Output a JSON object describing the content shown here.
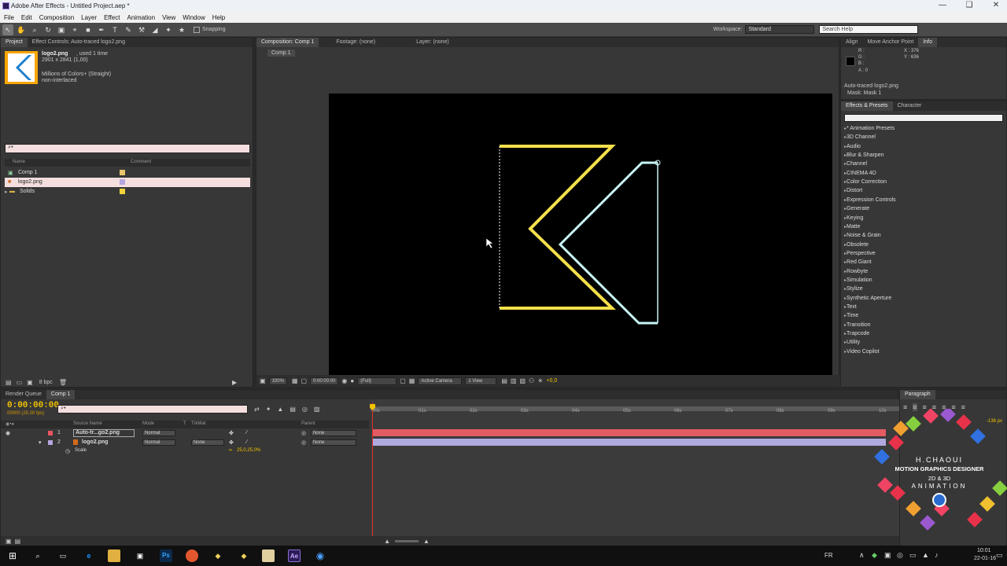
{
  "window": {
    "title": "Adobe After Effects - Untitled Project.aep *",
    "controls": [
      "—",
      "❑",
      "✕"
    ]
  },
  "menu": [
    "File",
    "Edit",
    "Composition",
    "Layer",
    "Effect",
    "Animation",
    "View",
    "Window",
    "Help"
  ],
  "toolbar": {
    "snapping_label": "Snapping",
    "workspace_label": "Workspace:",
    "workspace_value": "Standard",
    "search_placeholder": "Search Help"
  },
  "project_panel": {
    "tab_project": "Project",
    "tab_effect_controls": "Effect Controls: Auto-traced logo2.png",
    "selected_name": "logo2.png",
    "used": ", used 1 time",
    "dimensions": "2901 x 2841 (1,00)",
    "colors": "Millions of Colors+ (Straight)",
    "interlace": "non-interlaced",
    "col_name": "Name",
    "col_comment": "Comment",
    "items": [
      {
        "name": "Comp 1",
        "icon": "composition-icon",
        "swatch": "#e8c36a"
      },
      {
        "name": "logo2.png",
        "icon": "image-file-icon",
        "swatch": "#b7a6e0"
      },
      {
        "name": "Solids",
        "icon": "folder-icon",
        "swatch": "#f0d23a"
      }
    ],
    "bpc": "8 bpc"
  },
  "comp_viewer": {
    "tab_comp": "Composition: Comp 1",
    "tab_footage": "Footage: (none)",
    "tab_layer": "Layer: (none)",
    "breadcrumb": "Comp 1",
    "zoom": "100%",
    "time": "0:00:00:00",
    "resolution": "(Full)",
    "camera": "Active Camera",
    "views": "1 View",
    "exposure": "+0,0"
  },
  "info_panel": {
    "tabs": [
      "Align",
      "Move Anchor Point",
      "Info"
    ],
    "r": "R :",
    "g": "G :",
    "b": "B :",
    "a": "A : 0",
    "x": "X : 376",
    "y": "Y : 636",
    "layer_name": "Auto-traced logo2.png",
    "mask": "Mask: Mask 1"
  },
  "effects_panel": {
    "tabs": [
      "Effects & Presets",
      "Character"
    ],
    "items": [
      "* Animation Presets",
      "3D Channel",
      "Audio",
      "Blur & Sharpen",
      "Channel",
      "CINEMA 4D",
      "Color Correction",
      "Distort",
      "Expression Controls",
      "Generate",
      "Keying",
      "Matte",
      "Noise & Grain",
      "Obsolete",
      "Perspective",
      "Red Giant",
      "Rowbyte",
      "Simulation",
      "Stylize",
      "Synthetic Aperture",
      "Text",
      "Time",
      "Transition",
      "Trapcode",
      "Utility",
      "Video Copilot"
    ]
  },
  "timeline": {
    "tab_render": "Render Queue",
    "tab_comp": "Comp 1",
    "timecode": "0:00:00:00",
    "fps": "00000 (25,00 fps)",
    "search_placeholder": "⌕▾",
    "columns": {
      "source": "Source Name",
      "mode": "Mode",
      "t": "T",
      "trkmat": "TrkMat",
      "parent": "Parent"
    },
    "layers": [
      {
        "num": "1",
        "name": "Auto-tr...go2.png",
        "mode": "Normal",
        "trkmat": "",
        "parent": "None",
        "color": "#e85560"
      },
      {
        "num": "2",
        "name": "logo2.png",
        "mode": "Normal",
        "trkmat": "None",
        "parent": "None",
        "color": "#b7a6e0"
      }
    ],
    "prop_name": "Scale",
    "prop_value": "25,0,25,0%",
    "ruler": [
      "00s",
      "01s",
      "02s",
      "03s",
      "04s",
      "05s",
      "06s",
      "07s",
      "08s",
      "09s",
      "10s"
    ],
    "bar_colors": {
      "layer1": "#e35b63",
      "layer2": "#aeaadf"
    }
  },
  "paragraph_panel": {
    "tab": "Paragraph",
    "px1": "px",
    "px2": "-136 px"
  },
  "watermark": {
    "name": "H.CHAOUI",
    "line1": "MOTION GRAPHICS DESIGNER",
    "line2": "2D & 3D",
    "line3": "ANIMATION"
  },
  "taskbar": {
    "lang": "FR",
    "time": "10:01",
    "date": "22-01-16"
  },
  "colors": {
    "accent_yellow": "#f4e04a",
    "trace_cyan": "#c8f4f4",
    "timecode": "#f2c200"
  }
}
